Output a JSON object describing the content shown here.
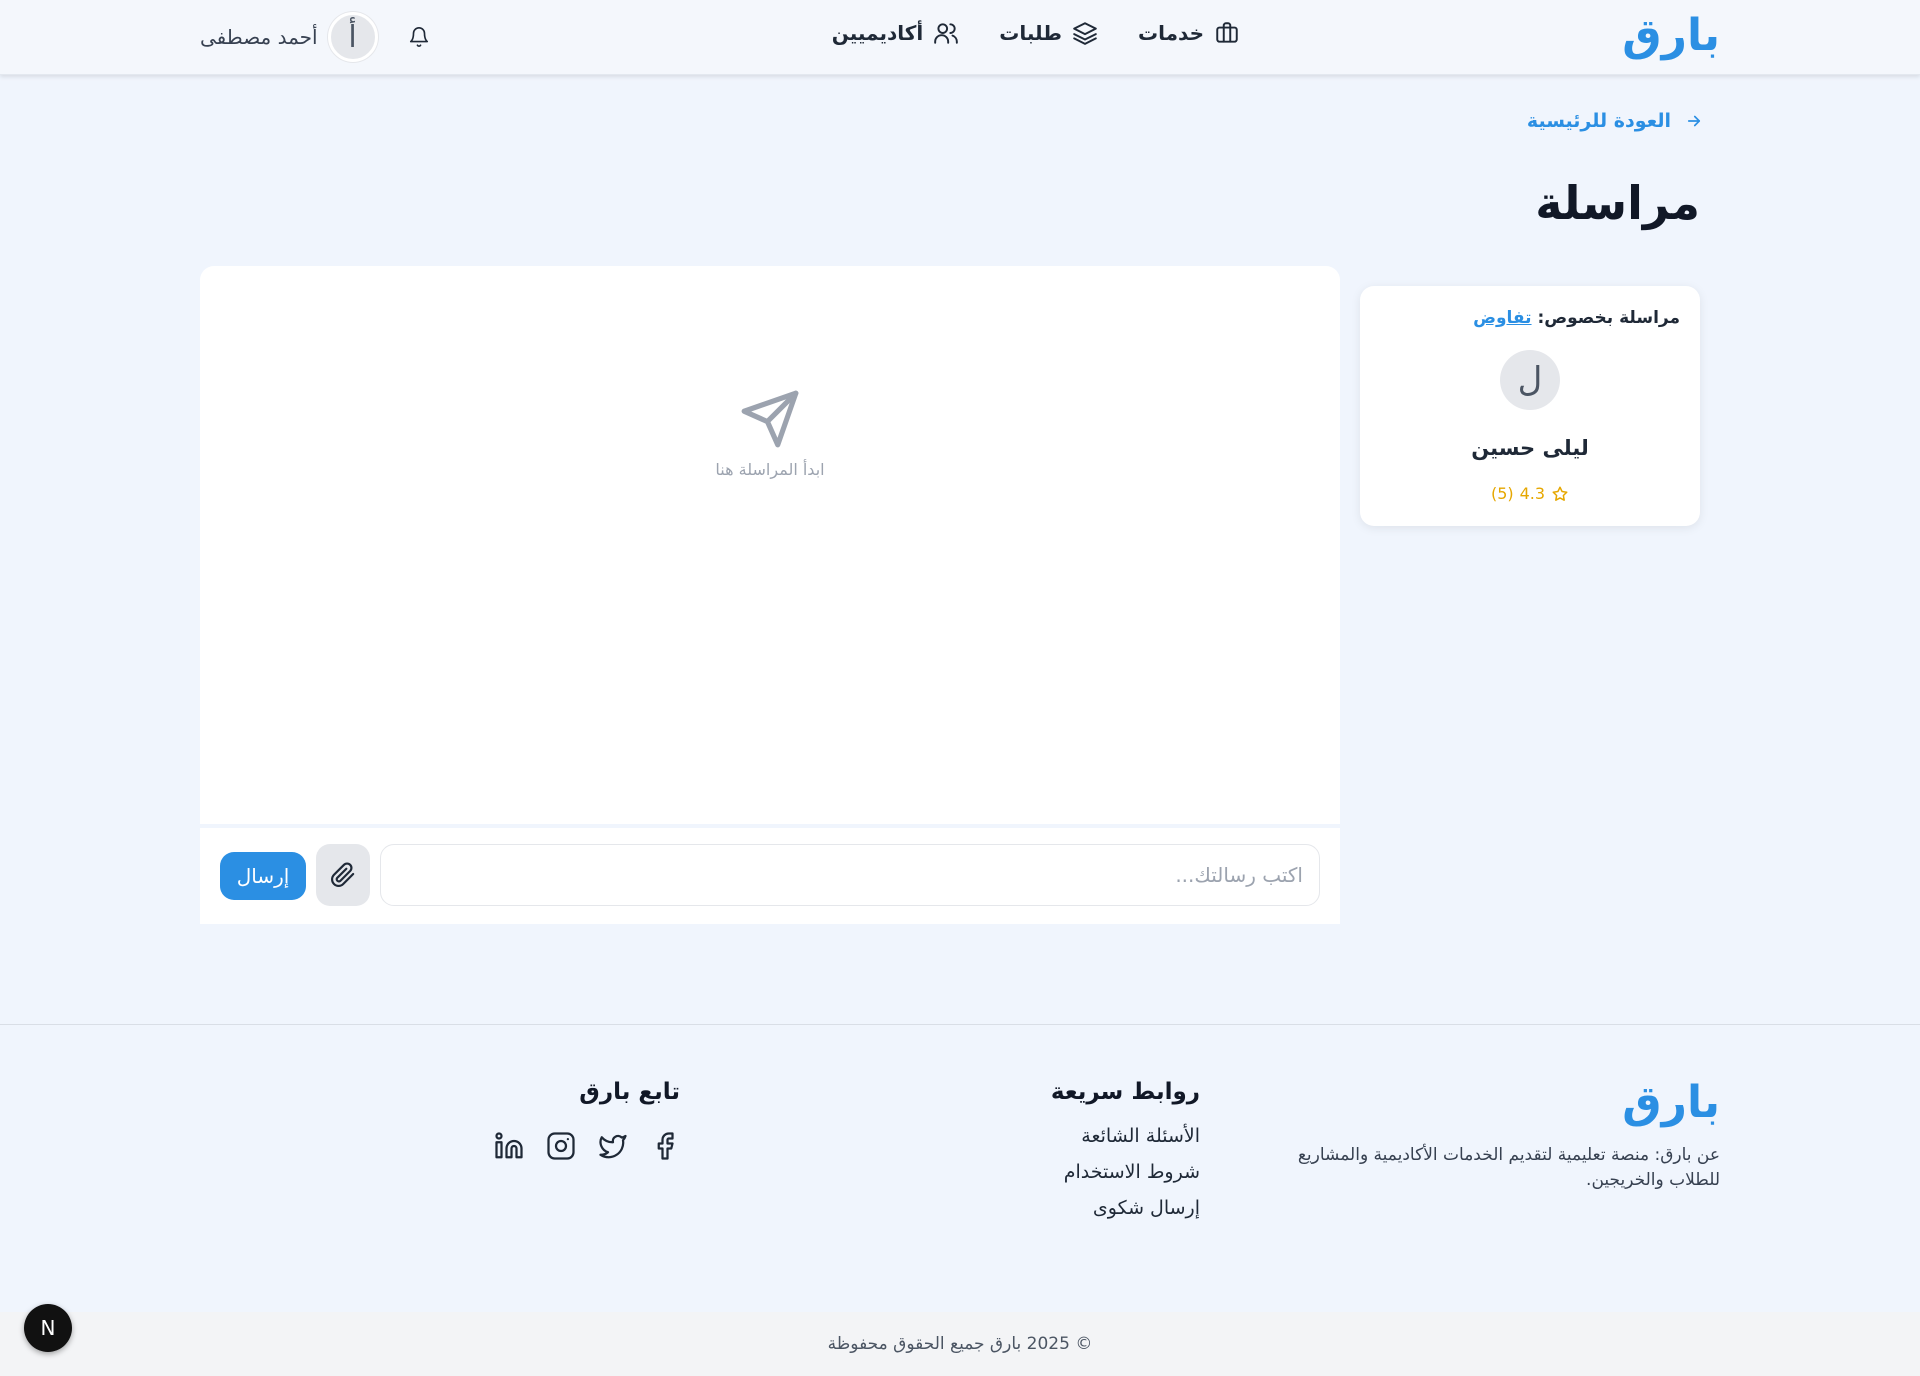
{
  "brand": {
    "name": "بارق",
    "color": "#2b8fe3"
  },
  "nav": {
    "items": [
      {
        "label": "خدمات",
        "icon": "briefcase-icon"
      },
      {
        "label": "طلبات",
        "icon": "layers-icon"
      },
      {
        "label": "أكاديميين",
        "icon": "users-icon"
      }
    ]
  },
  "user": {
    "name": "أحمد مصطفى",
    "initial": "أ"
  },
  "back_link": {
    "label": "العودة للرئيسية"
  },
  "page": {
    "title": "مراسلة"
  },
  "contact": {
    "regarding_label": "مراسلة بخصوص:",
    "regarding_topic": "تفاوض",
    "initial": "ل",
    "name": "ليلى حسين",
    "rating": "4.3",
    "rating_count": "(5)"
  },
  "chat": {
    "empty_text": "ابدأ المراسلة هنا",
    "input_placeholder": "اكتب رسالتك...",
    "send_label": "إرسال"
  },
  "footer": {
    "about": "عن بارق: منصة تعليمية لتقديم الخدمات الأكاديمية والمشاريع للطلاب والخريجين.",
    "links_title": "روابط سريعة",
    "links": [
      "الأسئلة الشائعة",
      "شروط الاستخدام",
      "إرسال شكوى"
    ],
    "follow_title": "تابع بارق",
    "socials": [
      "facebook-icon",
      "twitter-icon",
      "instagram-icon",
      "linkedin-icon"
    ],
    "copyright": "© 2025 بارق جميع الحقوق محفوظة"
  },
  "dev_badge": {
    "label": "N"
  }
}
